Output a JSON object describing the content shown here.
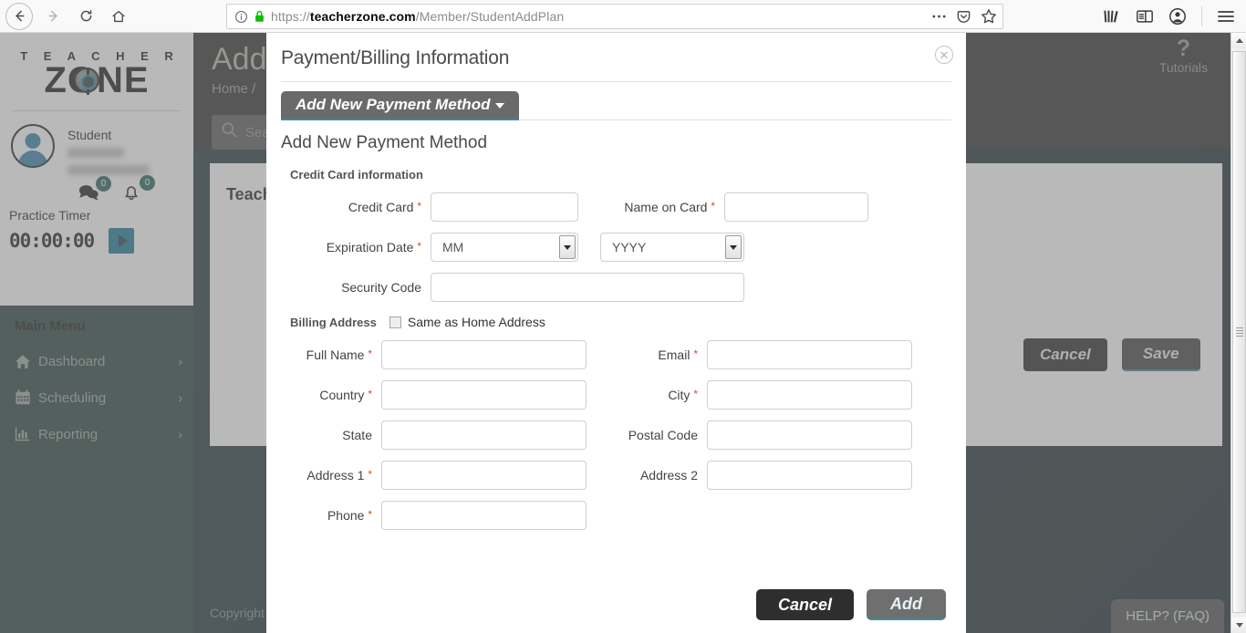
{
  "browser": {
    "url_scheme": "https://",
    "url_host": "teacherzone.com",
    "url_path": "/Member/StudentAddPlan",
    "back_icon": "back-arrow-icon",
    "forward_icon": "forward-arrow-icon",
    "reload_icon": "reload-icon",
    "home_icon": "home-icon",
    "info_icon": "page-info-icon",
    "lock_icon": "secure-lock-icon",
    "more_icon": "ellipsis-icon",
    "pocket_icon": "pocket-icon",
    "bookmark_icon": "star-bookmark-icon",
    "library_icon": "library-icon",
    "sidebar_icon": "sidebar-icon",
    "account_icon": "account-icon",
    "menu_icon": "hamburger-menu-icon"
  },
  "sidebar": {
    "logo_top": "T E A C H E R",
    "logo_bottom": "ZONE",
    "profile_role": "Student",
    "message_badge": "0",
    "bell_badge": "0",
    "practice_timer_label": "Practice Timer",
    "timer_value": "00:00:00",
    "play_icon": "play-icon",
    "menu_title": "Main Menu",
    "items": [
      {
        "label": "Dashboard",
        "icon": "home-icon"
      },
      {
        "label": "Scheduling",
        "icon": "calendar-icon"
      },
      {
        "label": "Reporting",
        "icon": "bar-chart-icon"
      }
    ]
  },
  "page": {
    "title": "Add",
    "breadcrumb": "Home /",
    "search_placeholder": "Sea",
    "card_title": "Teach",
    "cancel_label": "Cancel",
    "save_label": "Save",
    "copyright": "Copyright",
    "tutorials_label": "Tutorials",
    "tutorials_icon": "question-mark-icon",
    "help_label": "HELP? (FAQ)"
  },
  "modal": {
    "title": "Payment/Billing Information",
    "close_icon": "close-circle-icon",
    "tab_label": "Add New Payment Method",
    "section_title": "Add New Payment Method",
    "credit_card_legend": "Credit Card information",
    "billing_legend": "Billing Address",
    "same_as_home_label": "Same as Home Address",
    "same_as_home_checked": false,
    "fields": {
      "credit_card": {
        "label": "Credit Card",
        "required": true,
        "value": ""
      },
      "name_on_card": {
        "label": "Name on Card",
        "required": true,
        "value": ""
      },
      "expiration_date": {
        "label": "Expiration Date",
        "required": true
      },
      "month": {
        "value": "MM"
      },
      "year": {
        "value": "YYYY"
      },
      "security_code": {
        "label": "Security Code",
        "required": false,
        "value": ""
      },
      "full_name": {
        "label": "Full Name",
        "required": true,
        "value": ""
      },
      "email": {
        "label": "Email",
        "required": true,
        "value": ""
      },
      "country": {
        "label": "Country",
        "required": true,
        "value": ""
      },
      "city": {
        "label": "City",
        "required": true,
        "value": ""
      },
      "state": {
        "label": "State",
        "required": false,
        "value": ""
      },
      "postal_code": {
        "label": "Postal Code",
        "required": false,
        "value": ""
      },
      "address1": {
        "label": "Address 1",
        "required": true,
        "value": ""
      },
      "address2": {
        "label": "Address 2",
        "required": false,
        "value": ""
      },
      "phone": {
        "label": "Phone",
        "required": true,
        "value": ""
      }
    },
    "cancel_label": "Cancel",
    "add_label": "Add"
  },
  "colors": {
    "accent_teal": "#0e7490",
    "menu_green": "#1e3b34",
    "required_red": "#d94a28",
    "tab_gray": "#6a6a6a"
  }
}
